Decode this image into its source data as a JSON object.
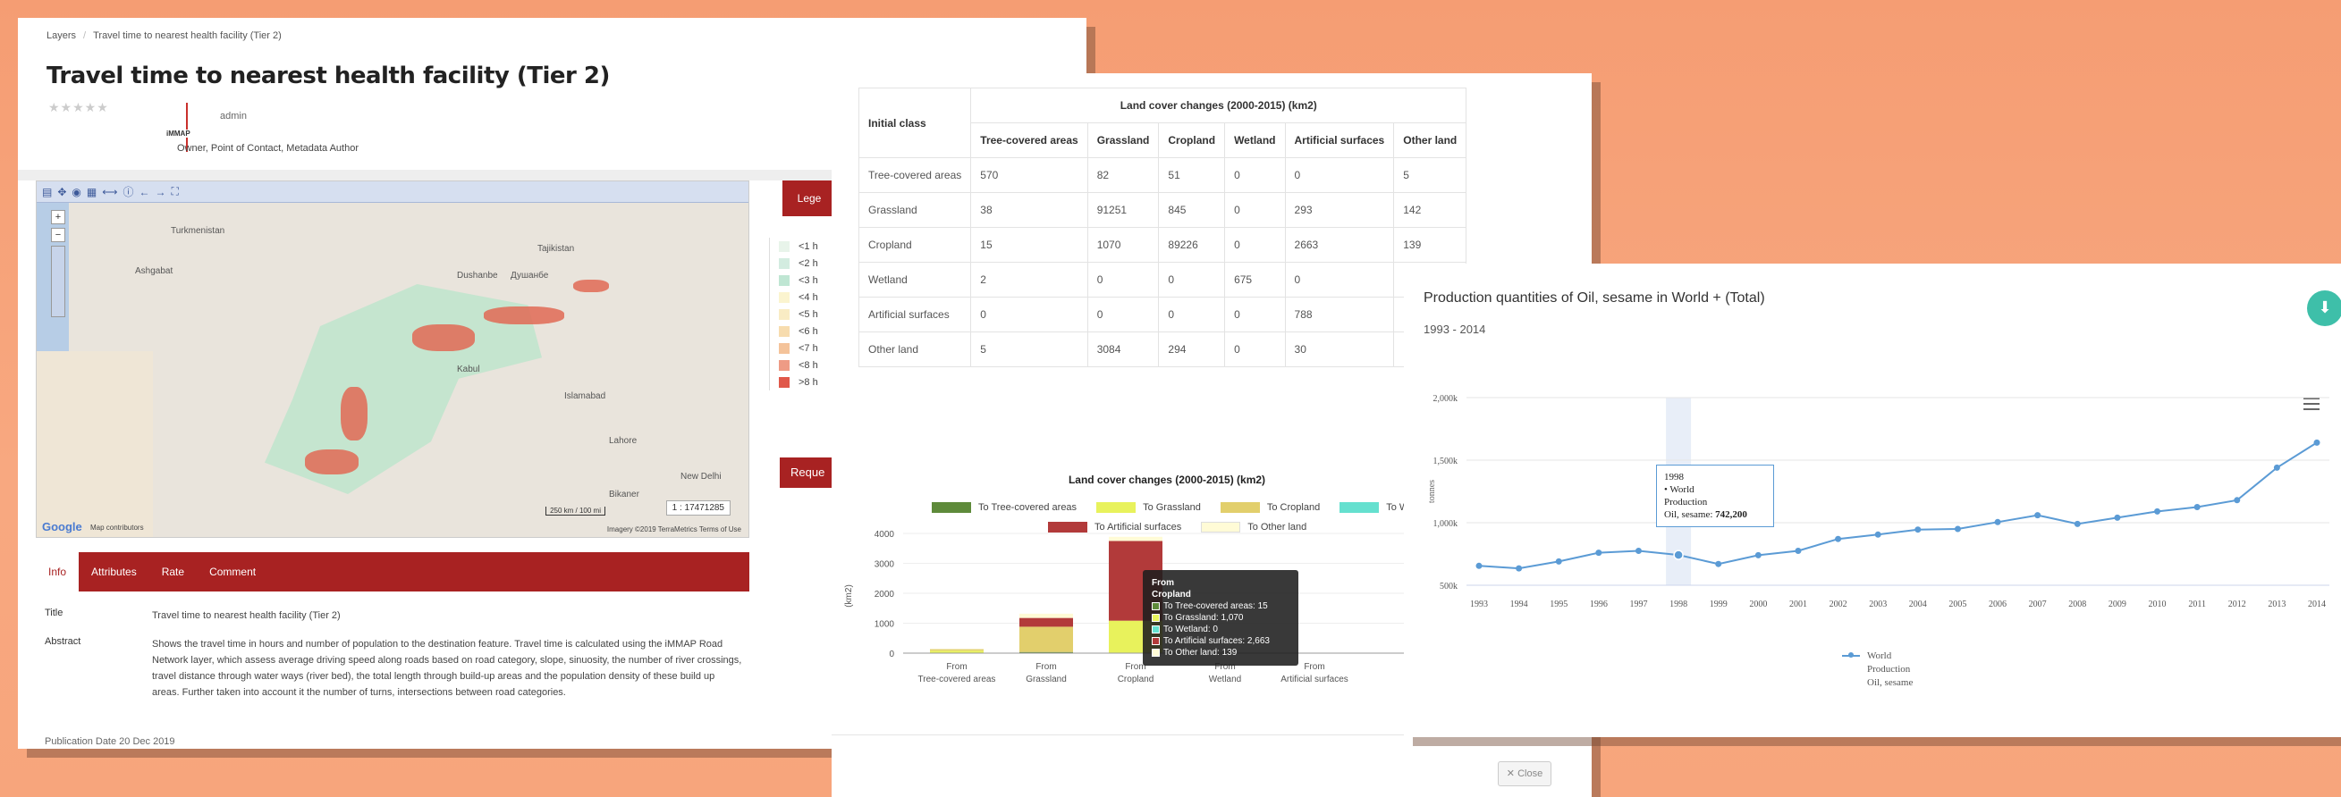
{
  "layer_page": {
    "breadcrumb": [
      "Layers",
      "Travel time to nearest health facility (Tier 2)"
    ],
    "title": "Travel time to nearest health facility (Tier 2)",
    "rating_stars": "★★★★★",
    "org_logo_text": "iMMAP",
    "owner_name": "admin",
    "owner_role": "Owner, Point of Contact, Metadata Author",
    "map": {
      "labels": [
        "Turkmenistan",
        "Tajikistan",
        "Dushanbe",
        "Душанбе",
        "Ashgabat",
        "Kabul",
        "Islamabad",
        "Lahore",
        "Bikaner",
        "New Delhi"
      ],
      "scale_text": "1 : 17471285",
      "scale_bar": "250 km / 100 mi",
      "attribution": "Imagery ©2019 TerraMetrics    Terms of Use",
      "google": "Google",
      "map_data": "Map contributors"
    },
    "legend_tab": "Lege",
    "legend": [
      {
        "label": "<1 h",
        "color": "#e8f4ea"
      },
      {
        "label": "<2 h",
        "color": "#d3ece0"
      },
      {
        "label": "<3 h",
        "color": "#bfe6d3"
      },
      {
        "label": "<4 h",
        "color": "#fbf4cf"
      },
      {
        "label": "<5 h",
        "color": "#f9ecc4"
      },
      {
        "label": "<6 h",
        "color": "#f7dcae"
      },
      {
        "label": "<7 h",
        "color": "#f4c39a"
      },
      {
        "label": "<8 h",
        "color": "#ee9b85"
      },
      {
        "label": ">8 h",
        "color": "#e0584a"
      }
    ],
    "request_btn": "Reque",
    "tabs": [
      "Info",
      "Attributes",
      "Rate",
      "Comment"
    ],
    "info": {
      "title_key": "Title",
      "title_val": "Travel time to nearest health facility (Tier 2)",
      "abstract_key": "Abstract",
      "abstract_val": "Shows the travel time in hours and number of population to the destination feature. Travel time is calculated using the iMMAP Road Network layer, which assess average driving speed along roads based on road category, slope, sinuosity, the number of river crossings, travel distance through water ways (river bed), the total length through build-up areas and the population density of these build up areas. Further taken into account it the number of turns, intersections between road categories.",
      "cut_text": "Publication Date    20 Dec 2019"
    }
  },
  "land_cover": {
    "table_header_group": "Land cover changes (2000-2015) (km2)",
    "columns": [
      "Initial class",
      "Tree-covered areas",
      "Grassland",
      "Cropland",
      "Wetland",
      "Artificial surfaces",
      "Other land"
    ],
    "rows": [
      [
        "Tree-covered areas",
        "570",
        "82",
        "51",
        "0",
        "0",
        "5"
      ],
      [
        "Grassland",
        "38",
        "91251",
        "845",
        "0",
        "293",
        "142"
      ],
      [
        "Cropland",
        "15",
        "1070",
        "89226",
        "0",
        "2663",
        "139"
      ],
      [
        "Wetland",
        "2",
        "0",
        "0",
        "675",
        "0",
        ""
      ],
      [
        "Artificial surfaces",
        "0",
        "0",
        "0",
        "0",
        "788",
        ""
      ],
      [
        "Other land",
        "5",
        "3084",
        "294",
        "0",
        "30",
        ""
      ]
    ],
    "chart_title": "Land cover changes (2000-2015) (km2)",
    "close_btn": "✕ Close",
    "tooltip": {
      "header1": "From",
      "header2": "Cropland",
      "lines": [
        "To Tree-covered areas: 15",
        "To Grassland: 1,070",
        "To Wetland: 0",
        "To Artificial surfaces: 2,663",
        "To Other land: 139"
      ],
      "colors": [
        "#5e8a3a",
        "#e8f25c",
        "#65e0cf",
        "#b23a3a",
        "#fffbd6"
      ]
    }
  },
  "chart_data": [
    {
      "type": "bar",
      "title": "Land cover changes (2000-2015) (km2)",
      "ylabel": "(km2)",
      "ylim": [
        0,
        4000
      ],
      "yticks": [
        0,
        1000,
        2000,
        3000,
        4000
      ],
      "categories": [
        "From Tree-covered areas",
        "From Grassland",
        "From Cropland",
        "From Wetland",
        "From Artificial surfaces"
      ],
      "category_lines": [
        [
          "From",
          "Tree-covered areas"
        ],
        [
          "From",
          "Grassland"
        ],
        [
          "From",
          "Cropland"
        ],
        [
          "From",
          "Wetland"
        ],
        [
          "From",
          "Artificial surfaces"
        ]
      ],
      "stacked": true,
      "series": [
        {
          "name": "To Tree-covered areas",
          "color": "#5e8a3a",
          "values": [
            0,
            38,
            15,
            2,
            0
          ]
        },
        {
          "name": "To Grassland",
          "color": "#e8f25c",
          "values": [
            82,
            0,
            1070,
            0,
            0
          ]
        },
        {
          "name": "To Cropland",
          "color": "#e2cf6c",
          "values": [
            51,
            845,
            0,
            0,
            0
          ]
        },
        {
          "name": "To Wetland",
          "color": "#65e0cf",
          "values": [
            0,
            0,
            0,
            0,
            0
          ]
        },
        {
          "name": "To Artificial surfaces",
          "color": "#b23a3a",
          "values": [
            0,
            293,
            2663,
            0,
            0
          ]
        },
        {
          "name": "To Other land",
          "color": "#fffbd6",
          "values": [
            5,
            142,
            139,
            0,
            0
          ]
        }
      ],
      "legend_display": [
        "To Tree-covered areas",
        "To Grassland",
        "To Cropland",
        "To Wet",
        "To Artificial surfaces",
        "To Other land"
      ]
    },
    {
      "type": "line",
      "title": "Production quantities of Oil, sesame in World + (Total)",
      "subtitle": "1993 - 2014",
      "ylabel": "tonnes",
      "ylim": [
        500000,
        2000000
      ],
      "yticks": [
        "500k",
        "1,000k",
        "1,500k",
        "2,000k"
      ],
      "ytick_values": [
        500000,
        1000000,
        1500000,
        2000000
      ],
      "x": [
        "1993",
        "1994",
        "1995",
        "1996",
        "1997",
        "1998",
        "1999",
        "2000",
        "2001",
        "2002",
        "2003",
        "2004",
        "2005",
        "2006",
        "2007",
        "2008",
        "2009",
        "2010",
        "2011",
        "2012",
        "2013",
        "2014"
      ],
      "series": [
        {
          "name": "World Production Oil, sesame",
          "color": "#5b9bd5",
          "values": [
            655000,
            635000,
            690000,
            760000,
            775000,
            742200,
            670000,
            740000,
            775000,
            870000,
            905000,
            945000,
            950000,
            1005000,
            1060000,
            990000,
            1040000,
            1090000,
            1125000,
            1180000,
            1440000,
            1640000
          ]
        }
      ],
      "tooltip": {
        "year": "1998",
        "series": "• World",
        "line2": "Production",
        "line3_label": "Oil, sesame:",
        "line3_value": "742,200"
      },
      "legend_lines": [
        "World",
        "Production",
        "Oil, sesame"
      ]
    }
  ],
  "production": {
    "title": "Production quantities of Oil, sesame in World + (Total)",
    "subtitle": "1993 - 2014",
    "download_icon": "⬇"
  }
}
